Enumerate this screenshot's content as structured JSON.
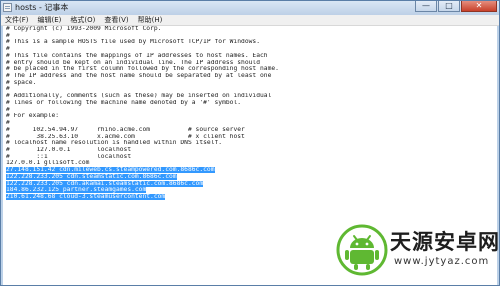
{
  "window": {
    "title": "hosts - 记事本",
    "minimize_glyph": "—",
    "maximize_glyph": "□",
    "close_glyph": "✕",
    "icon": "notepad-icon"
  },
  "menubar": {
    "items": [
      {
        "label": "文件(F)"
      },
      {
        "label": "编辑(E)"
      },
      {
        "label": "格式(O)"
      },
      {
        "label": "查看(V)"
      },
      {
        "label": "帮助(H)"
      }
    ]
  },
  "editor": {
    "lines": [
      {
        "text": "# Copyright (c) 1993-2009 Microsoft Corp.",
        "sel": ""
      },
      {
        "text": "#",
        "sel": ""
      },
      {
        "text": "# This is a sample HOSTS file used by Microsoft TCP/IP for Windows.",
        "sel": ""
      },
      {
        "text": "#",
        "sel": ""
      },
      {
        "text": "# This file contains the mappings of IP addresses to host names. Each",
        "sel": ""
      },
      {
        "text": "# entry should be kept on an individual line. The IP address should",
        "sel": ""
      },
      {
        "text": "# be placed in the first column followed by the corresponding host name.",
        "sel": ""
      },
      {
        "text": "# The IP address and the host name should be separated by at least one",
        "sel": ""
      },
      {
        "text": "# space.",
        "sel": ""
      },
      {
        "text": "#",
        "sel": ""
      },
      {
        "text": "# Additionally, comments (such as these) may be inserted on individual",
        "sel": ""
      },
      {
        "text": "# lines or following the machine name denoted by a '#' symbol.",
        "sel": ""
      },
      {
        "text": "#",
        "sel": ""
      },
      {
        "text": "# For example:",
        "sel": ""
      },
      {
        "text": "#",
        "sel": ""
      },
      {
        "text": "#      102.54.94.97     rhino.acme.com          # source server",
        "sel": ""
      },
      {
        "text": "#       38.25.63.10     x.acme.com              # x client host",
        "sel": ""
      },
      {
        "text": "# localhost name resolution is handled within DNS itself.",
        "sel": ""
      },
      {
        "text": "#\t127.0.0.1       localhost",
        "sel": ""
      },
      {
        "text": "#\t::1             localhost",
        "sel": ""
      },
      {
        "text": "127.0.0.1 gllisoft.com",
        "sel": ""
      },
      {
        "text": "",
        "sel": "27.148.151.42 cdn.mileweb.cs.steampowered.com.8686c.com"
      },
      {
        "text": "",
        "sel": "122.228.233.205 cdn.steamstatic.com.8686c.com"
      },
      {
        "text": "",
        "sel": "122.228.233.205 cdn.akamai.steamstatic.com.8686c.com"
      },
      {
        "text": "",
        "sel": "184.86.232.125 partner.steamgames.com"
      },
      {
        "text": "",
        "sel": "210.61.248.68 cloud-3.steamusercontent.com"
      },
      {
        "text": "",
        "sel": ""
      }
    ]
  },
  "watermark": {
    "name": "天源安卓网",
    "url": "www.jytyaz.com",
    "icon": "android-robot-icon",
    "colors": {
      "green": "#5fb832",
      "dark": "#1e1e1e"
    }
  },
  "colors": {
    "selection": "#3399ff",
    "titlebar": "#bdd0e7",
    "close": "#c8412b"
  }
}
